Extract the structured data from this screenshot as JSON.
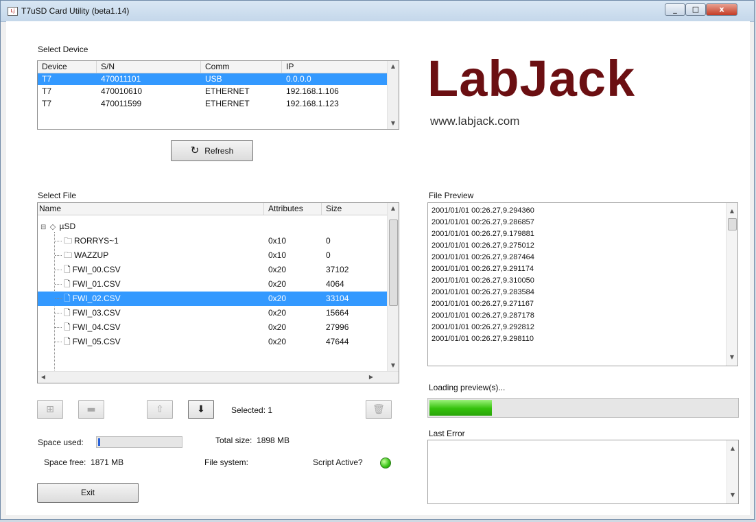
{
  "window": {
    "title": "T7uSD Card Utility (beta1.14)",
    "icon": "labjack-app-icon",
    "close_glyph": "x",
    "min_glyph": "_",
    "max_glyph": "□"
  },
  "device_section": {
    "label": "Select Device",
    "columns": [
      "Device",
      "S/N",
      "Comm",
      "IP"
    ],
    "rows": [
      {
        "device": "T7",
        "sn": "470011101",
        "comm": "USB",
        "ip": "0.0.0.0",
        "selected": true
      },
      {
        "device": "T7",
        "sn": "470010610",
        "comm": "ETHERNET",
        "ip": "192.168.1.106",
        "selected": false
      },
      {
        "device": "T7",
        "sn": "470011599",
        "comm": "ETHERNET",
        "ip": "192.168.1.123",
        "selected": false
      }
    ],
    "refresh_label": "Refresh",
    "refresh_icon": "refresh-icon"
  },
  "brand": {
    "logo_text": "LabJack",
    "logo_color": "#6b0f12",
    "url": "www.labjack.com"
  },
  "file_section": {
    "label": "Select File",
    "columns": [
      "Name",
      "Attributes",
      "Size"
    ],
    "root": "µSD",
    "items": [
      {
        "name": "RORRYS~1",
        "type": "folder",
        "attributes": "0x10",
        "size": "0",
        "selected": false
      },
      {
        "name": "WAZZUP",
        "type": "folder",
        "attributes": "0x10",
        "size": "0",
        "selected": false
      },
      {
        "name": "FWI_00.CSV",
        "type": "file",
        "attributes": "0x20",
        "size": "37102",
        "selected": false
      },
      {
        "name": "FWI_01.CSV",
        "type": "file",
        "attributes": "0x20",
        "size": "4064",
        "selected": false
      },
      {
        "name": "FWI_02.CSV",
        "type": "file",
        "attributes": "0x20",
        "size": "33104",
        "selected": true
      },
      {
        "name": "FWI_03.CSV",
        "type": "file",
        "attributes": "0x20",
        "size": "15664",
        "selected": false
      },
      {
        "name": "FWI_04.CSV",
        "type": "file",
        "attributes": "0x20",
        "size": "27996",
        "selected": false
      },
      {
        "name": "FWI_05.CSV",
        "type": "file",
        "attributes": "0x20",
        "size": "47644",
        "selected": false
      }
    ],
    "selected_label": "Selected:",
    "selected_count": "1",
    "toolbar_icons": [
      "new-file-icon",
      "new-folder-icon",
      "upload-icon",
      "download-icon",
      "trash-icon"
    ]
  },
  "space": {
    "used_label": "Space used:",
    "used_fraction": 0.014,
    "total_label": "Total size:",
    "total_value": "1898 MB",
    "free_label": "Space free:",
    "free_value": "1871 MB",
    "fs_label": "File system:",
    "fs_value": "",
    "script_label": "Script Active?",
    "script_active": true
  },
  "exit_label": "Exit",
  "preview": {
    "label": "File Preview",
    "lines": [
      "2001/01/01 00:26.27,9.294360",
      "2001/01/01 00:26.27,9.286857",
      "2001/01/01 00:26.27,9.179881",
      "2001/01/01 00:26.27,9.275012",
      "2001/01/01 00:26.27,9.287464",
      "2001/01/01 00:26.27,9.291174",
      "2001/01/01 00:26.27,9.310050",
      "2001/01/01 00:26.27,9.283584",
      "2001/01/01 00:26.27,9.271167",
      "2001/01/01 00:26.27,9.287178",
      "2001/01/01 00:26.27,9.292812",
      "2001/01/01 00:26.27,9.298110"
    ],
    "loading_label": "Loading preview(s)...",
    "loading_fraction": 0.21
  },
  "error": {
    "label": "Last Error",
    "value": ""
  },
  "colors": {
    "selection": "#3399ff",
    "progress_green": "#34c10c",
    "used_bar": "#2a62d8"
  }
}
